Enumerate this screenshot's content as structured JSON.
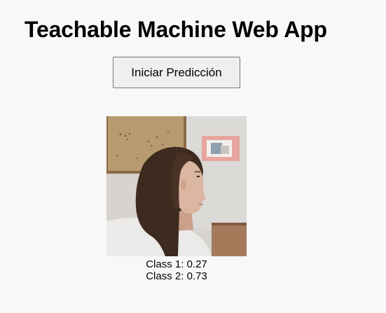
{
  "header": {
    "title": "Teachable Machine Web App"
  },
  "controls": {
    "start_label": "Iniciar Predicción"
  },
  "webcam": {
    "icon": "webcam-frame",
    "description_colors": {
      "wall": "#d9d6d2",
      "corkboard": "#b9986c",
      "hair": "#3c2a1f",
      "skin": "#d9b39e",
      "shirt": "#eceae8",
      "frame": "#e7a39c"
    }
  },
  "predictions": [
    {
      "label": "Class 1",
      "value": "0.27",
      "text": "Class 1: 0.27"
    },
    {
      "label": "Class 2",
      "value": "0.73",
      "text": "Class 2: 0.73"
    }
  ]
}
